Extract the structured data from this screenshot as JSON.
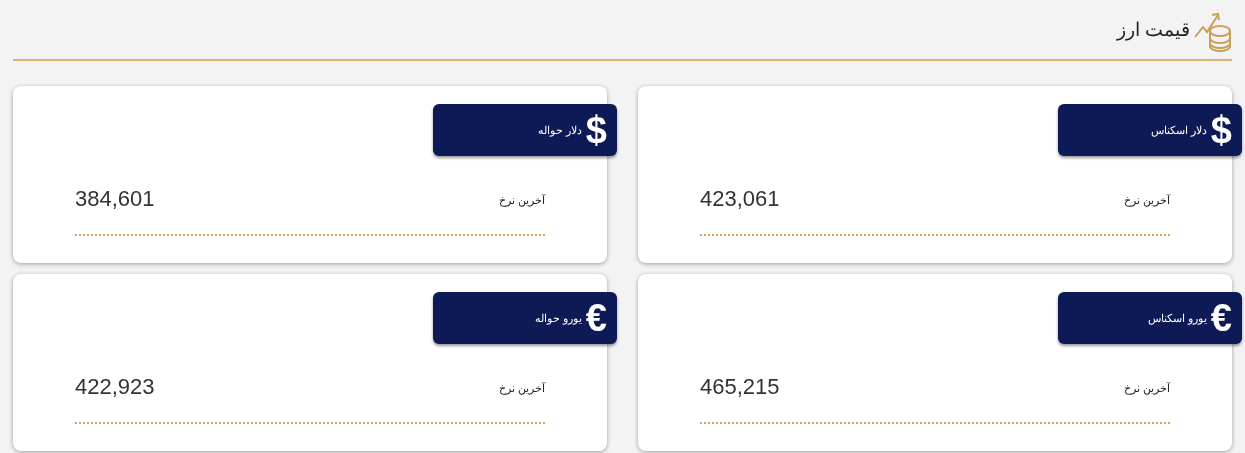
{
  "header": {
    "title": "قیمت ارز"
  },
  "cards": [
    {
      "symbol": "$",
      "name": "دلار اسکناس",
      "label": "آخرین نرخ",
      "value": "423,061"
    },
    {
      "symbol": "$",
      "name": "دلار حواله",
      "label": "آخرین نرخ",
      "value": "384,601"
    },
    {
      "symbol": "€",
      "name": "یورو اسکناس",
      "label": "آخرین نرخ",
      "value": "465,215"
    },
    {
      "symbol": "€",
      "name": "یورو حواله",
      "label": "آخرین نرخ",
      "value": "422,923"
    }
  ]
}
